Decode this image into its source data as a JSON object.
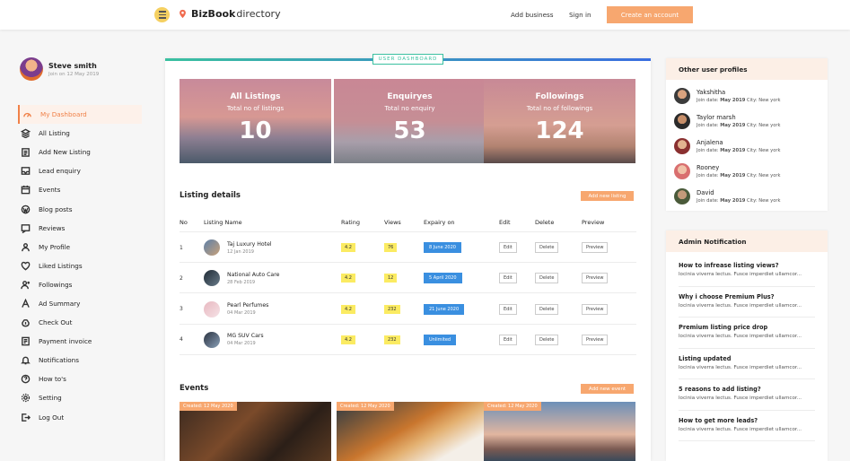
{
  "header": {
    "brand_bold": "BizBook",
    "brand_light": "directory",
    "add_business": "Add business",
    "sign_in": "Sign in",
    "create_account": "Create an account"
  },
  "profile": {
    "name": "Steve smith",
    "joined": "Join on 12 May 2019"
  },
  "menu": [
    {
      "label": "My Dashboard",
      "icon": "dashboard-icon",
      "active": true
    },
    {
      "label": "All Listing",
      "icon": "layers-icon"
    },
    {
      "label": "Add New Listing",
      "icon": "clipboard-icon"
    },
    {
      "label": "Lead enquiry",
      "icon": "inbox-icon"
    },
    {
      "label": "Events",
      "icon": "calendar-icon"
    },
    {
      "label": "Blog posts",
      "icon": "wordpress-icon"
    },
    {
      "label": "Reviews",
      "icon": "review-icon"
    },
    {
      "label": "My Profile",
      "icon": "user-icon"
    },
    {
      "label": "Liked Listings",
      "icon": "heart-icon"
    },
    {
      "label": "Followings",
      "icon": "user-plus-icon"
    },
    {
      "label": "Ad Summary",
      "icon": "ad-icon"
    },
    {
      "label": "Check Out",
      "icon": "money-bag-icon"
    },
    {
      "label": "Payment invoice",
      "icon": "invoice-icon"
    },
    {
      "label": "Notifications",
      "icon": "bell-icon"
    },
    {
      "label": "How to's",
      "icon": "help-icon"
    },
    {
      "label": "Setting",
      "icon": "gear-icon"
    },
    {
      "label": "Log Out",
      "icon": "logout-icon"
    }
  ],
  "dashboard": {
    "badge": "USER DASHBOARD"
  },
  "stats": [
    {
      "title": "All Listings",
      "sub": "Total no of listings",
      "value": "10"
    },
    {
      "title": "Enquiryes",
      "sub": "Total no enquiry",
      "value": "53"
    },
    {
      "title": "Followings",
      "sub": "Total no of followings",
      "value": "124"
    }
  ],
  "listing": {
    "title": "Listing details",
    "add_label": "Add new listing",
    "columns": {
      "no": "No",
      "name": "Listing Name",
      "rating": "Rating",
      "views": "Views",
      "expiry": "Expairy on",
      "edit": "Edit",
      "delete": "Delete",
      "preview": "Preview"
    },
    "rows": [
      {
        "no": "1",
        "name": "Taj Luxury Hotel",
        "date": "12 Jan 2019",
        "rating": "4.2",
        "views": "76",
        "expiry": "8 June 2020"
      },
      {
        "no": "2",
        "name": "National Auto Care",
        "date": "28 Feb 2019",
        "rating": "4.2",
        "views": "12",
        "expiry": "5 April 2020"
      },
      {
        "no": "3",
        "name": "Pearl Perfumes",
        "date": "04 Mar 2019",
        "rating": "4.2",
        "views": "232",
        "expiry": "21 June 2020"
      },
      {
        "no": "4",
        "name": "MG SUV Cars",
        "date": "04 Mar 2019",
        "rating": "4.2",
        "views": "232",
        "expiry": "Unlimited"
      }
    ],
    "edit_btn": "Edit",
    "delete_btn": "Delete",
    "preview_btn": "Preview"
  },
  "events": {
    "title": "Events",
    "add_label": "Add new event",
    "created": [
      "Created: 12 May 2020",
      "Created: 12 May 2020",
      "Created: 12 May 2020"
    ]
  },
  "other_profiles": {
    "title": "Other user profiles",
    "join_label": "Join date:",
    "city_label": "City:",
    "users": [
      {
        "name": "Yakshitha",
        "date": "May 2019",
        "city": "New york"
      },
      {
        "name": "Taylor marsh",
        "date": "May 2019",
        "city": "New york"
      },
      {
        "name": "Anjalena",
        "date": "May 2019",
        "city": "New york"
      },
      {
        "name": "Rooney",
        "date": "May 2019",
        "city": "New york"
      },
      {
        "name": "David",
        "date": "May 2019",
        "city": "New york"
      }
    ]
  },
  "admin": {
    "title": "Admin Notification",
    "items": [
      {
        "title": "How to infrease listing views?",
        "desc": "locinia viverra lectus. Fusce imperdiet ullamcor..."
      },
      {
        "title": "Why i choose Premium Plus?",
        "desc": "locinia viverra lectus. Fusce imperdiet ullamcor..."
      },
      {
        "title": "Premium listing price drop",
        "desc": "locinia viverra lectus. Fusce imperdiet ullamcor..."
      },
      {
        "title": "Listing updated",
        "desc": "locinia viverra lectus. Fusce imperdiet ullamcor..."
      },
      {
        "title": "5 reasons to add listing?",
        "desc": "locinia viverra lectus. Fusce imperdiet ullamcor..."
      },
      {
        "title": "How to get more leads?",
        "desc": "locinia viverra lectus. Fusce imperdiet ullamcor..."
      }
    ]
  },
  "colors": {
    "accent": "#f7a76f",
    "accent_text": "#f08148",
    "blue": "#3a8fe0",
    "yellow": "#fbeb62",
    "green": "#3ac0a0"
  }
}
